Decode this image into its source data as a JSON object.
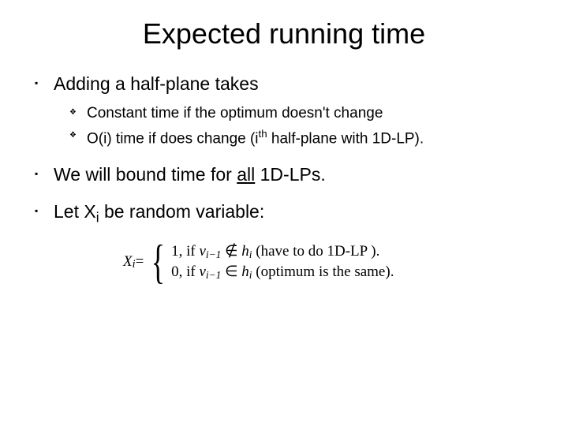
{
  "title": "Expected running time",
  "bullets": {
    "b1": "Adding a half-plane takes",
    "sub1": "Constant time if the optimum doesn't change",
    "sub2_a": "O(i) time if does change (i",
    "sub2_sup": "th",
    "sub2_b": " half-plane with 1D-LP).",
    "b2_a": "We will bound time for ",
    "b2_all": "all",
    "b2_b": " 1D-LPs.",
    "b3_a": "Let X",
    "b3_sub": "i",
    "b3_b": " be random variable:"
  },
  "formula": {
    "lhs_var": "X",
    "lhs_sub": "i",
    "eq": " = ",
    "case1_val": "1,",
    "case1_if": " if ",
    "case1_v": "v",
    "case1_vsub": "i−1",
    "case1_notin": " ∉ ",
    "case1_h": "h",
    "case1_hsub": "i",
    "case1_tail": " (have to do 1D-LP   ).",
    "case2_val": "0,",
    "case2_if": " if ",
    "case2_v": "v",
    "case2_vsub": "i−1",
    "case2_in": " ∈ ",
    "case2_h": "h",
    "case2_hsub": "i",
    "case2_tail": " (optimum is the same)."
  }
}
